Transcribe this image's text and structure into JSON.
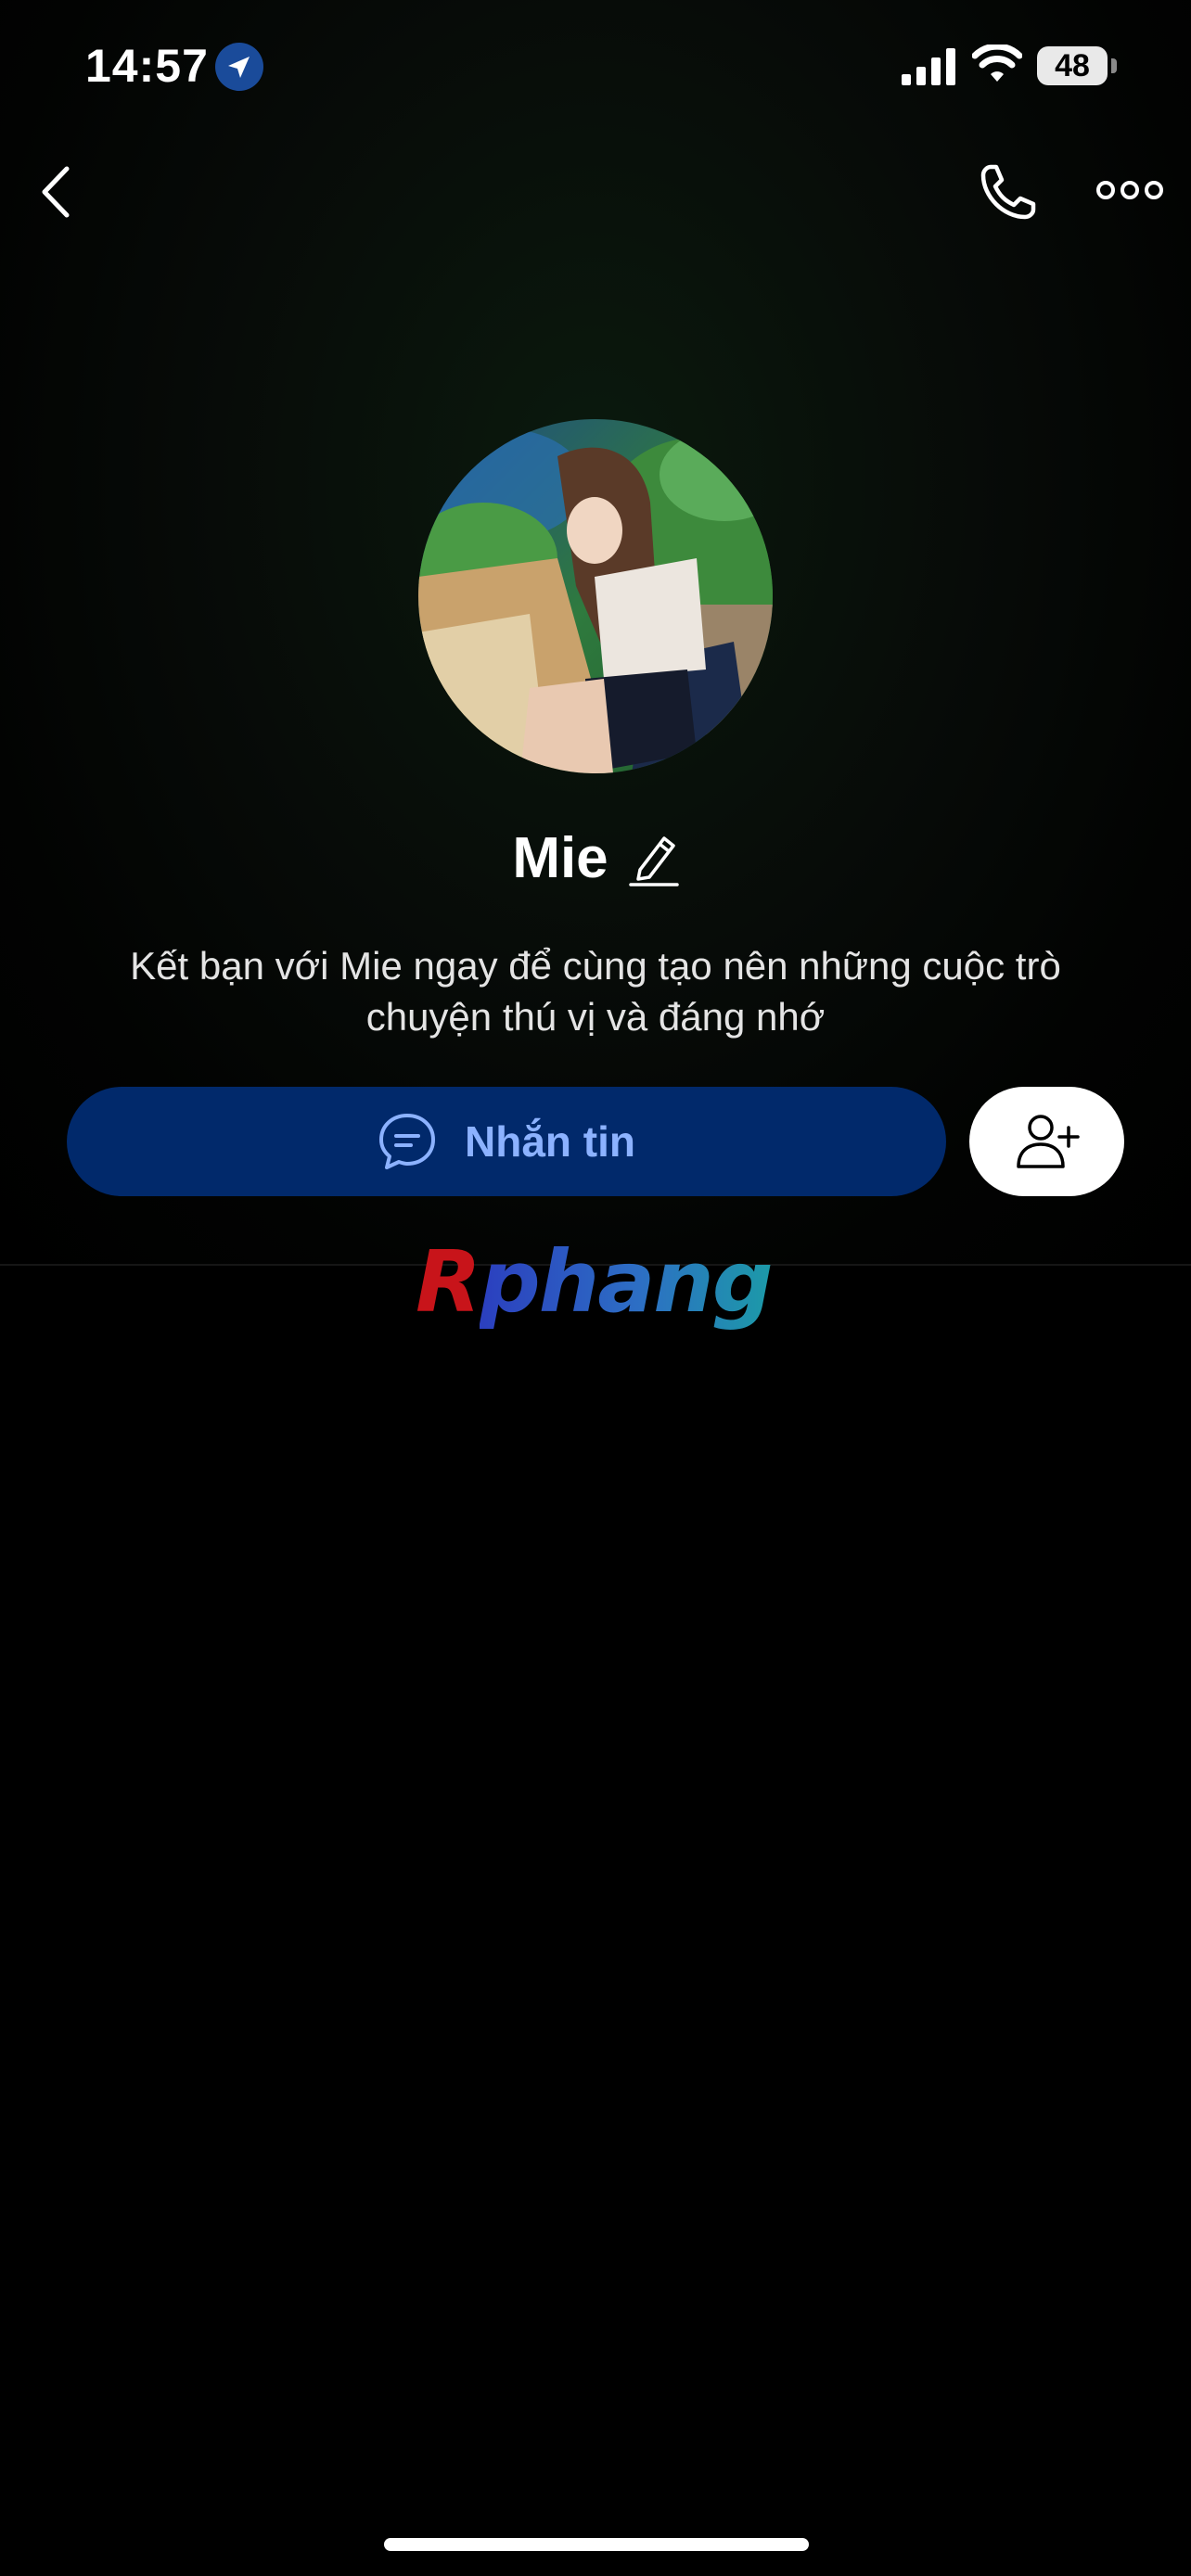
{
  "status_bar": {
    "time": "14:57",
    "battery": "48",
    "icons": [
      "location-arrow-icon",
      "cellular-signal-icon",
      "wifi-icon",
      "battery-icon"
    ]
  },
  "nav": {
    "icons": [
      "chevron-left-icon",
      "phone-icon",
      "more-dots-icon"
    ]
  },
  "profile": {
    "name": "Mie",
    "subtitle_line1": "Kết bạn với Mie ngay để cùng tạo nên những cuộc trò",
    "subtitle_line2": "chuyện thú vị và đáng nhớ"
  },
  "actions": {
    "message_label": "Nhắn tin",
    "message_icon": "chat-bubble-icon",
    "add_friend_icon": "add-user-icon"
  },
  "watermark": {
    "first_letter": "R",
    "rest": "phang"
  },
  "colors": {
    "background": "#000000",
    "message_button_bg": "#01296b",
    "message_button_text": "#8cb2ff",
    "add_button_bg": "#ffffff",
    "location_badge": "#1a4b9a"
  }
}
